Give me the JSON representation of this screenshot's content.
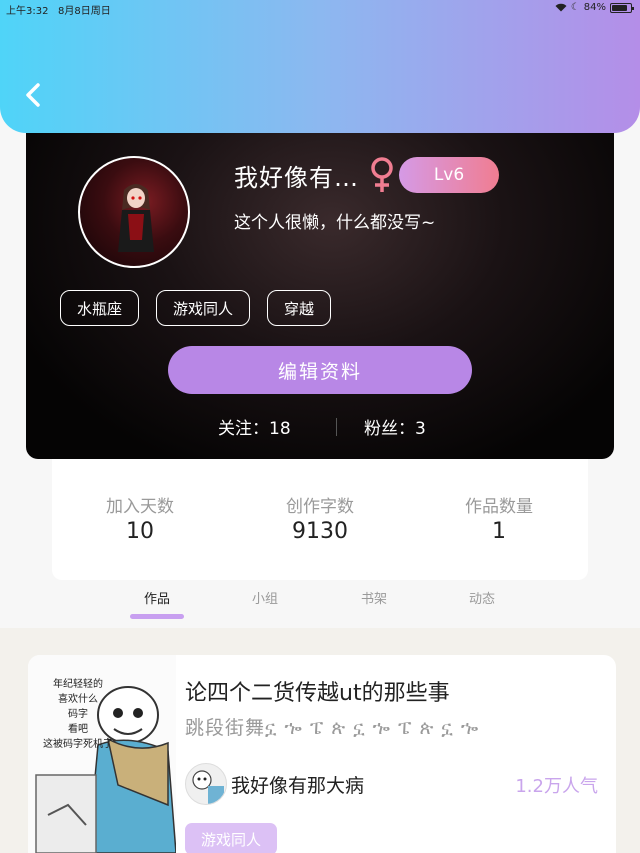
{
  "status_bar": {
    "time": "上午3:32",
    "date": "8月8日周日",
    "battery": "84%",
    "battery_level": 0.84
  },
  "profile": {
    "nickname": "我好像有…",
    "gender_icon": "female-symbol-icon",
    "level": "Lv6",
    "bio": "这个人很懒，什么都没写~",
    "tags": [
      "水瓶座",
      "游戏同人",
      "穿越"
    ],
    "edit_button": "编辑资料",
    "following": "关注：18",
    "followers": "粉丝：3"
  },
  "stats": [
    {
      "label": "加入天数",
      "value": "10"
    },
    {
      "label": "创作字数",
      "value": "9130"
    },
    {
      "label": "作品数量",
      "value": "1"
    }
  ],
  "tabs": [
    "作品",
    "小组",
    "书架",
    "动态"
  ],
  "active_tab": "作品",
  "work": {
    "cover_text": "年纪轻轻的\n喜欢什么\n码字\n看吧\n这被码字死机了",
    "title": "论四个二货传越ut的那些事",
    "subtitle": "跳段街舞ኗ ኈ ፔ ጵ ኗ ኈ ፔ ጵ ኗ ኈ",
    "author": "我好像有那大病",
    "popularity": "1.2万人气",
    "tag": "游戏同人"
  },
  "colors": {
    "header_gradient_start": "#4fd4f8",
    "header_gradient_end": "#b48ee8",
    "accent_purple": "#b887e6",
    "level_badge_start": "#d59ae6",
    "level_badge_end": "#f07d91",
    "gender_pink": "#f07d91",
    "popularity": "#c9a5ec"
  }
}
